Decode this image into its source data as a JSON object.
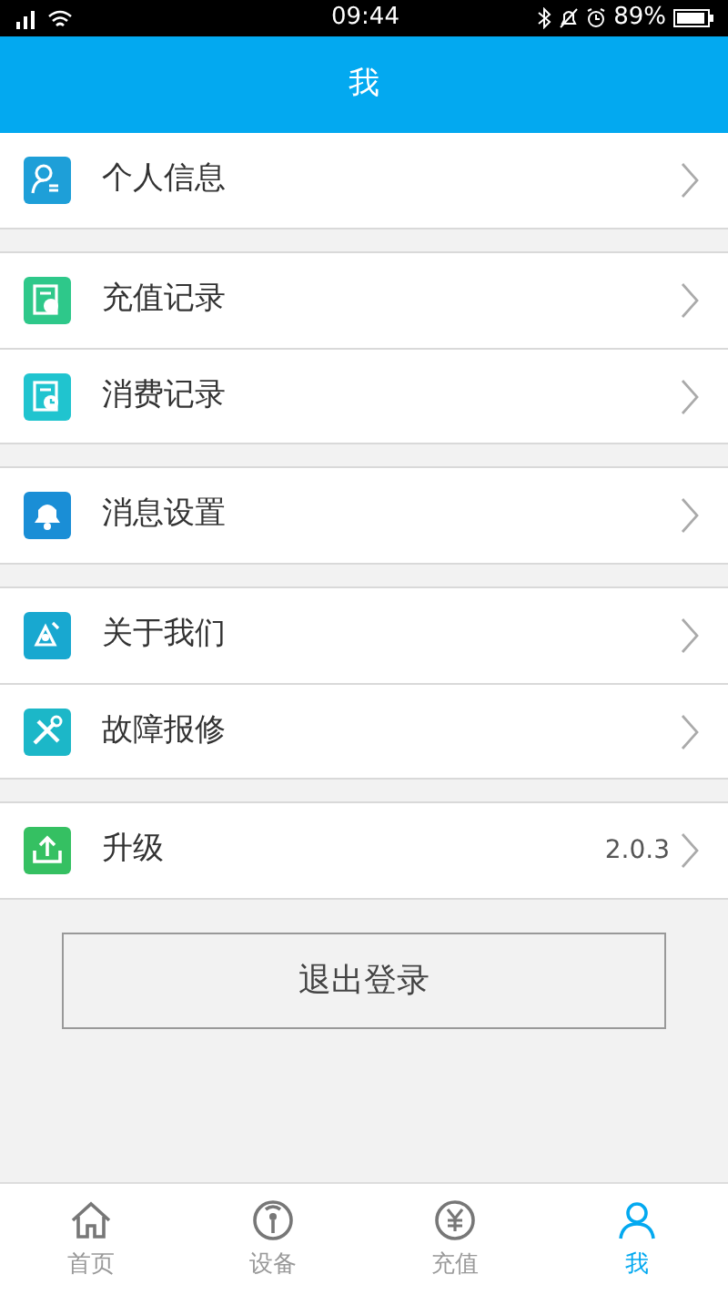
{
  "status_bar": {
    "time": "09:44",
    "battery": "89%"
  },
  "header": {
    "title": "我"
  },
  "groups": [
    {
      "items": [
        {
          "kind": "profile",
          "label": "个人信息"
        }
      ]
    },
    {
      "items": [
        {
          "kind": "recharge",
          "label": "充值记录"
        },
        {
          "kind": "spending",
          "label": "消费记录"
        }
      ]
    },
    {
      "items": [
        {
          "kind": "notify",
          "label": "消息设置"
        }
      ]
    },
    {
      "items": [
        {
          "kind": "about",
          "label": "关于我们"
        },
        {
          "kind": "repair",
          "label": "故障报修"
        }
      ]
    },
    {
      "items": [
        {
          "kind": "upgrade",
          "label": "升级",
          "value": "2.0.3"
        }
      ]
    }
  ],
  "logout_button": "退出登录",
  "tab_bar": [
    {
      "kind": "home",
      "label": "首页",
      "selected": false
    },
    {
      "kind": "device",
      "label": "设备",
      "selected": false
    },
    {
      "kind": "recharge",
      "label": "充值",
      "selected": false
    },
    {
      "kind": "me",
      "label": "我",
      "selected": true
    }
  ]
}
